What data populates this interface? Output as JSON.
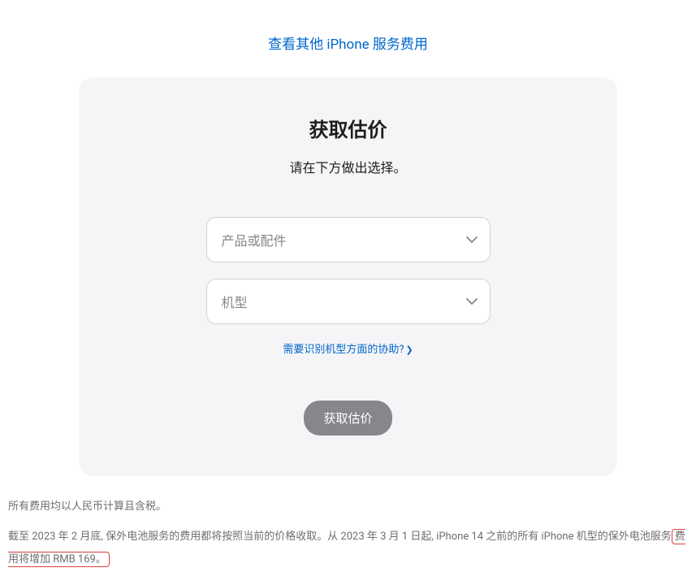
{
  "topLink": {
    "text": "查看其他 iPhone 服务费用"
  },
  "card": {
    "title": "获取估价",
    "subtitle": "请在下方做出选择。",
    "select1": {
      "placeholder": "产品或配件"
    },
    "select2": {
      "placeholder": "机型"
    },
    "helpLink": {
      "text": "需要识别机型方面的协助?"
    },
    "submitButton": {
      "label": "获取估价"
    }
  },
  "footer": {
    "line1": "所有费用均以人民币计算且含税。",
    "line2_pre": "截至 2023 年 2 月底, 保外电池服务的费用都将按照当前的价格收取。从 2023 年 3 月 1 日起, iPhone 14 之前的所有 iPhone 机型的保外电池服务",
    "line2_highlight": "费用将增加 RMB 169。"
  }
}
